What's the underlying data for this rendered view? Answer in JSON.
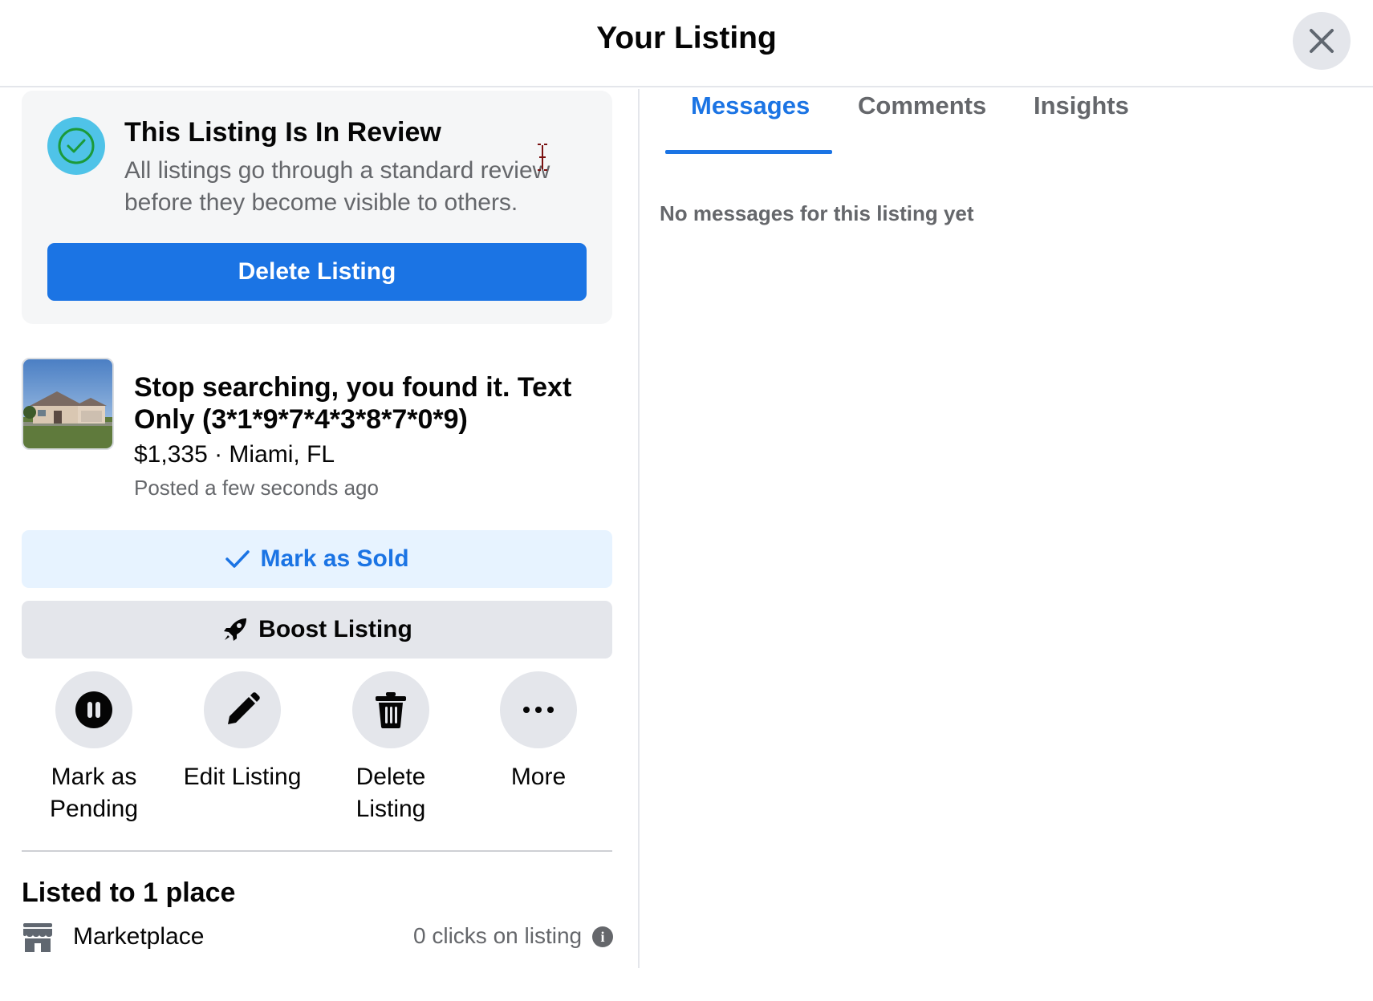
{
  "header": {
    "title": "Your Listing"
  },
  "review": {
    "title": "This Listing Is In Review",
    "description": "All listings go through a standard review before they become visible to others.",
    "delete_label": "Delete Listing",
    "icon": "check-circle-icon",
    "icon_color": "#4fc3e8"
  },
  "listing": {
    "title": "Stop searching, you found it. Text Only (3*1*9*7*4*3*8*7*0*9)",
    "price_location": "$1,335 · Miami, FL",
    "posted": "Posted a few seconds ago"
  },
  "buttons": {
    "mark_sold": "Mark as Sold",
    "boost": "Boost Listing"
  },
  "actions": [
    {
      "label": "Mark as Pending",
      "icon": "pause-icon"
    },
    {
      "label": "Edit Listing",
      "icon": "pencil-icon"
    },
    {
      "label": "Delete Listing",
      "icon": "trash-icon"
    },
    {
      "label": "More",
      "icon": "more-icon"
    }
  ],
  "places": {
    "heading": "Listed to 1 place",
    "items": [
      {
        "name": "Marketplace",
        "clicks": "0 clicks on listing",
        "icon": "marketplace-icon"
      }
    ]
  },
  "tabs": [
    {
      "label": "Messages",
      "active": true
    },
    {
      "label": "Comments",
      "active": false
    },
    {
      "label": "Insights",
      "active": false
    }
  ],
  "messages": {
    "empty_text": "No messages for this listing yet"
  },
  "colors": {
    "accent": "#1b74e4",
    "secondary_text": "#65676b",
    "button_gray": "#e4e6eb",
    "accent_light": "#e7f3ff"
  }
}
